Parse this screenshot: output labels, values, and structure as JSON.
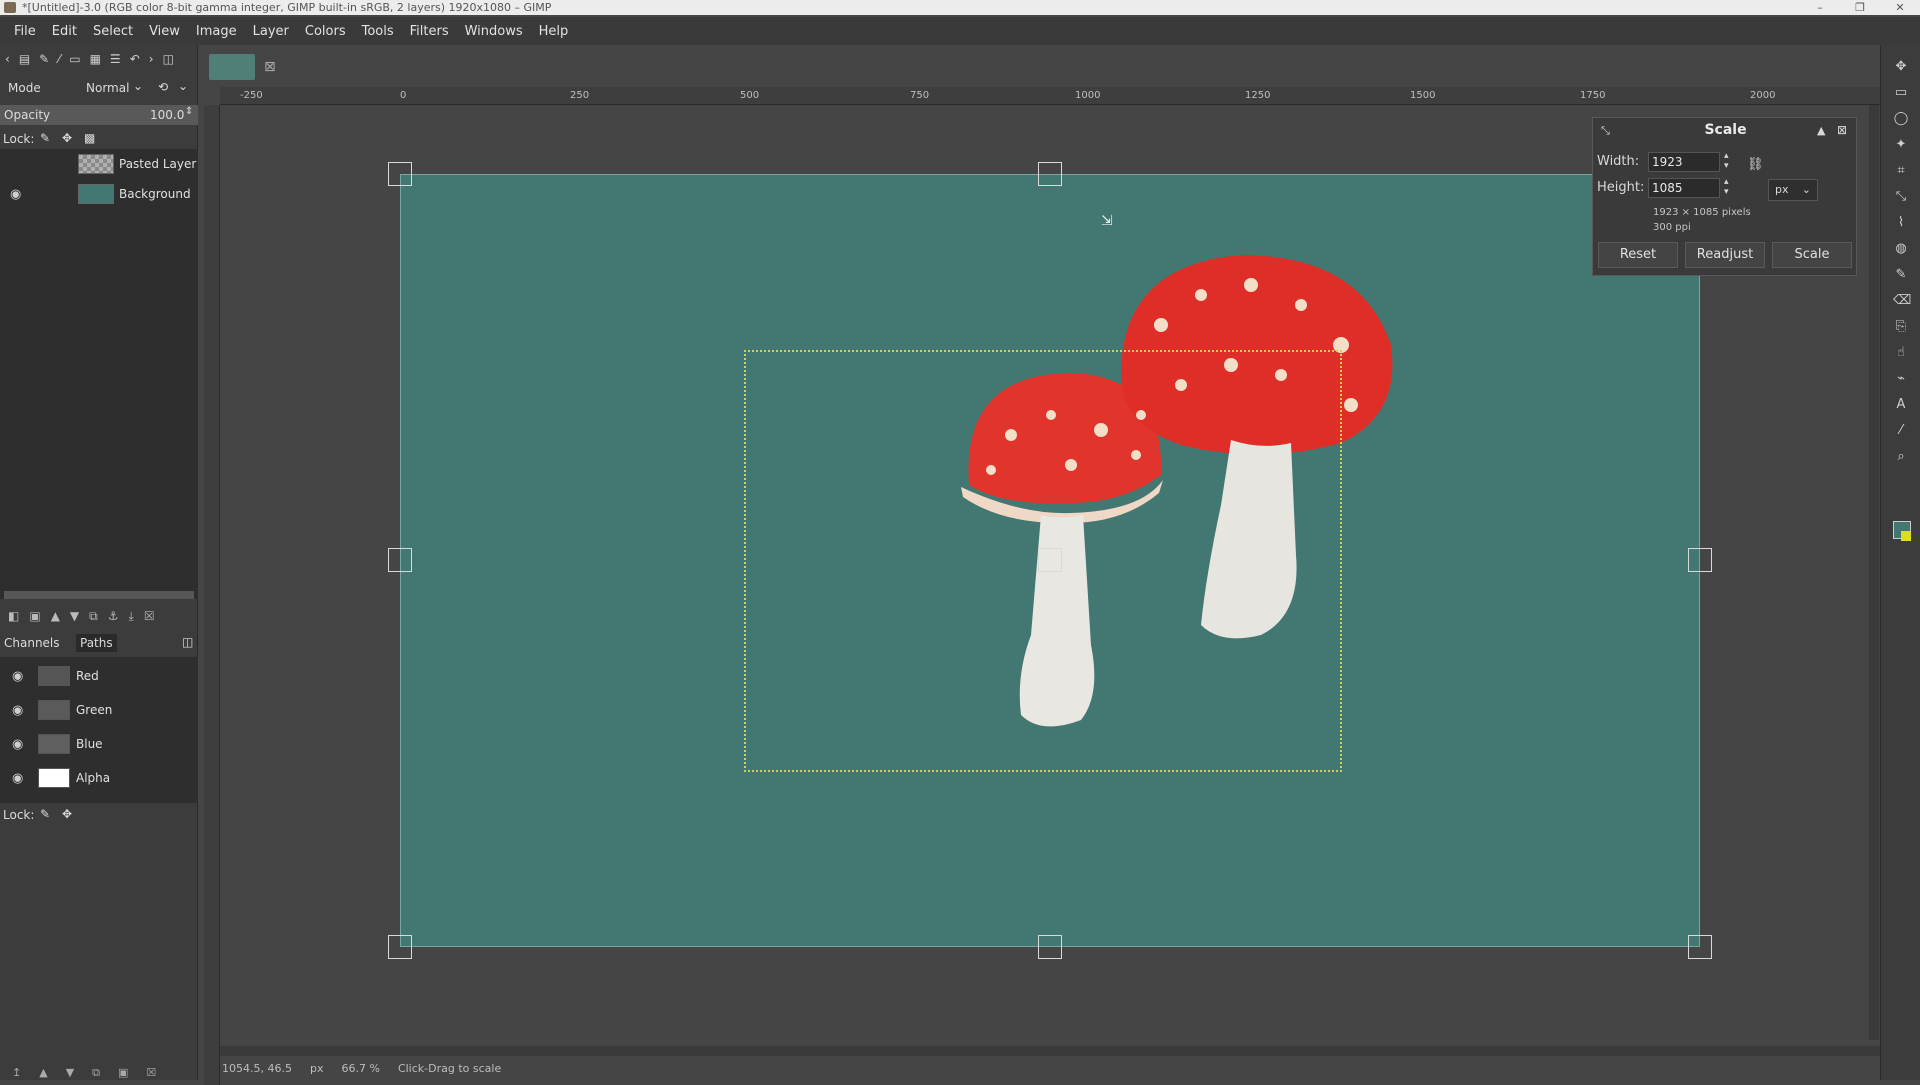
{
  "window": {
    "title": "*[Untitled]-3.0 (RGB color 8-bit gamma integer, GIMP built-in sRGB, 2 layers) 1920x1080 – GIMP"
  },
  "menu": [
    "File",
    "Edit",
    "Select",
    "View",
    "Image",
    "Layer",
    "Colors",
    "Tools",
    "Filters",
    "Windows",
    "Help"
  ],
  "layers_panel": {
    "mode_label": "Mode",
    "mode_value": "Normal",
    "opacity_label": "Opacity",
    "opacity_value": "100.0",
    "lock_label": "Lock:",
    "layers": [
      {
        "name": "Pasted Layer",
        "visible": false,
        "thumb_color": "#9a9a9a"
      },
      {
        "name": "Background",
        "visible": true,
        "thumb_color": "#427871"
      }
    ]
  },
  "channels_panel": {
    "tabs": [
      "Channels",
      "Paths"
    ],
    "channels": [
      {
        "name": "Red",
        "thumb_color": "#555555"
      },
      {
        "name": "Green",
        "thumb_color": "#5a5a5a"
      },
      {
        "name": "Blue",
        "thumb_color": "#5f5f5f"
      },
      {
        "name": "Alpha",
        "thumb_color": "#ffffff"
      }
    ],
    "lock_label": "Lock:"
  },
  "ruler": {
    "h_labels": [
      "-250",
      "0",
      "250",
      "500",
      "750",
      "1000",
      "1250",
      "1500",
      "1750",
      "2000"
    ]
  },
  "scale_dialog": {
    "title": "Scale",
    "width_label": "Width:",
    "width_value": "1923",
    "height_label": "Height:",
    "height_value": "1085",
    "unit": "px",
    "size_info": "1923 × 1085 pixels",
    "resolution_info": "300 ppi",
    "reset_label": "Reset",
    "readjust_label": "Readjust",
    "scale_label": "Scale"
  },
  "status_bar": {
    "coords": "1054.5, 46.5",
    "unit": "px",
    "zoom": "66.7 %",
    "message": "Click-Drag to scale"
  },
  "colors": {
    "canvas_teal": "#427871",
    "selection": "#d8d04a",
    "foreground": "#427871",
    "background": "#dede20"
  }
}
